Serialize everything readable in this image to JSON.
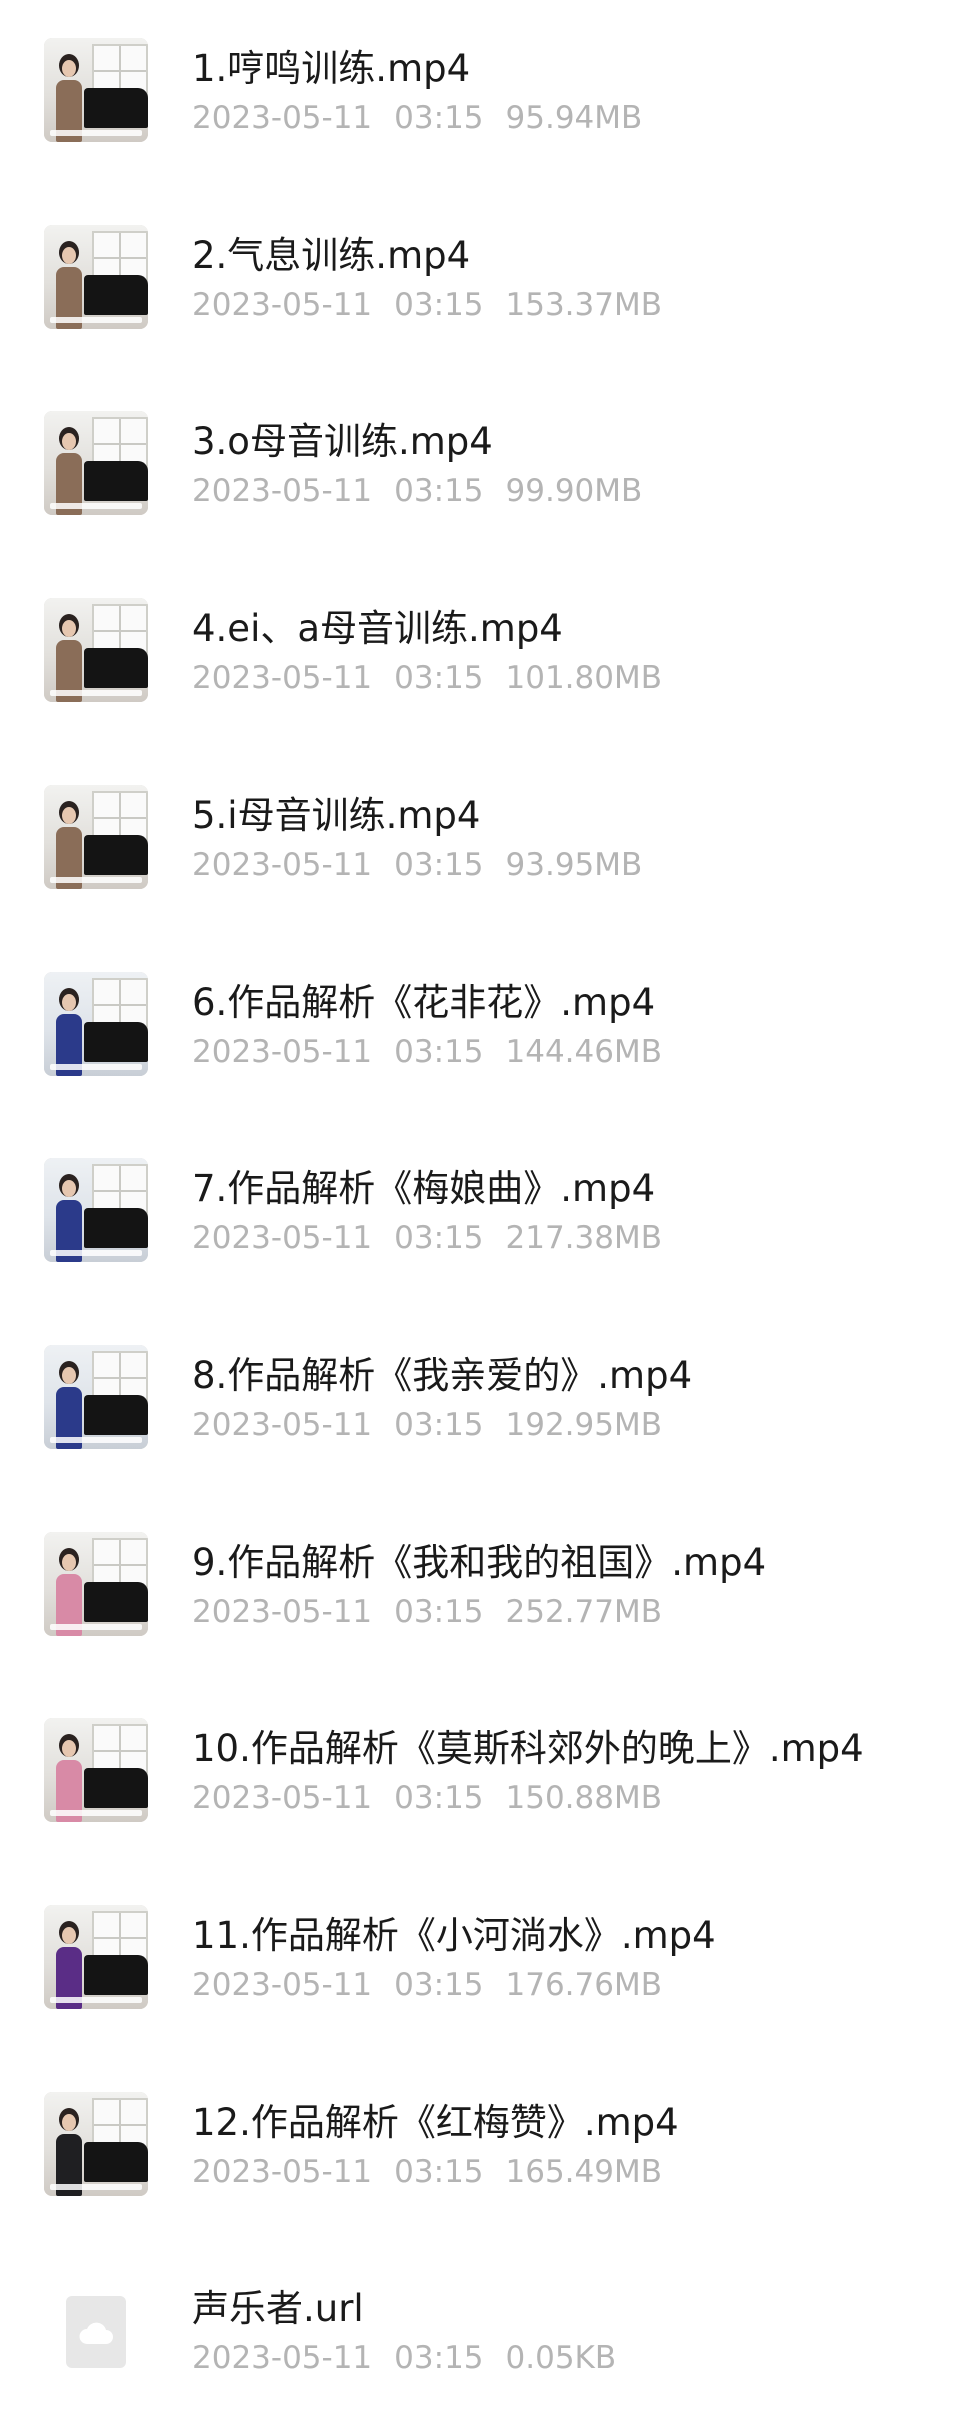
{
  "files": [
    {
      "name": "1.哼鸣训练.mp4",
      "date": "2023-05-11",
      "time": "03:15",
      "size": "95.94MB",
      "icon": "video-thumbnail",
      "tone": "tan"
    },
    {
      "name": "2.气息训练.mp4",
      "date": "2023-05-11",
      "time": "03:15",
      "size": "153.37MB",
      "icon": "video-thumbnail",
      "tone": "tan"
    },
    {
      "name": "3.o母音训练.mp4",
      "date": "2023-05-11",
      "time": "03:15",
      "size": "99.90MB",
      "icon": "video-thumbnail",
      "tone": "tan"
    },
    {
      "name": "4.ei、a母音训练.mp4",
      "date": "2023-05-11",
      "time": "03:15",
      "size": "101.80MB",
      "icon": "video-thumbnail",
      "tone": "tan"
    },
    {
      "name": "5.i母音训练.mp4",
      "date": "2023-05-11",
      "time": "03:15",
      "size": "93.95MB",
      "icon": "video-thumbnail",
      "tone": "tan"
    },
    {
      "name": "6.作品解析《花非花》.mp4",
      "date": "2023-05-11",
      "time": "03:15",
      "size": "144.46MB",
      "icon": "video-thumbnail",
      "tone": "blue"
    },
    {
      "name": "7.作品解析《梅娘曲》.mp4",
      "date": "2023-05-11",
      "time": "03:15",
      "size": "217.38MB",
      "icon": "video-thumbnail",
      "tone": "blue"
    },
    {
      "name": "8.作品解析《我亲爱的》.mp4",
      "date": "2023-05-11",
      "time": "03:15",
      "size": "192.95MB",
      "icon": "video-thumbnail",
      "tone": "blue"
    },
    {
      "name": "9.作品解析《我和我的祖国》.mp4",
      "date": "2023-05-11",
      "time": "03:15",
      "size": "252.77MB",
      "icon": "video-thumbnail",
      "tone": "pink"
    },
    {
      "name": "10.作品解析《莫斯科郊外的晚上》.mp4",
      "date": "2023-05-11",
      "time": "03:15",
      "size": "150.88MB",
      "icon": "video-thumbnail",
      "tone": "pink"
    },
    {
      "name": "11.作品解析《小河淌水》.mp4",
      "date": "2023-05-11",
      "time": "03:15",
      "size": "176.76MB",
      "icon": "video-thumbnail",
      "tone": "purple"
    },
    {
      "name": "12.作品解析《红梅赞》.mp4",
      "date": "2023-05-11",
      "time": "03:15",
      "size": "165.49MB",
      "icon": "video-thumbnail",
      "tone": "dark"
    },
    {
      "name": "声乐者.url",
      "date": "2023-05-11",
      "time": "03:15",
      "size": "0.05KB",
      "icon": "cloud-file-icon",
      "tone": "file"
    }
  ],
  "colors": {
    "name_text": "#1a1a1a",
    "meta_text": "#b4b4b4",
    "file_icon_bg": "#e7e7e7",
    "cloud_icon": "#ffffff"
  }
}
